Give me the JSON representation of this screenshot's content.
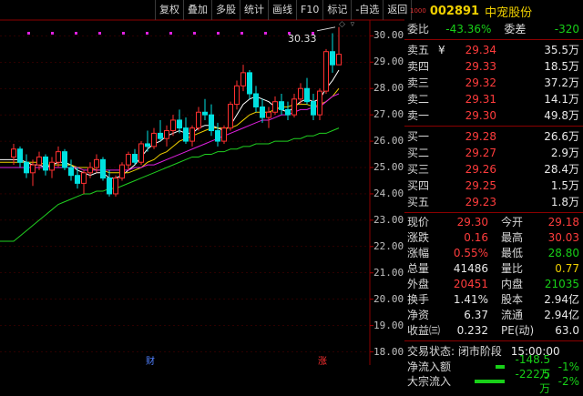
{
  "toolbar": {
    "buttons": [
      "复权",
      "叠加",
      "多股",
      "统计",
      "画线",
      "F10",
      "标记",
      "-自选",
      "返回"
    ]
  },
  "chart": {
    "y_labels": [
      "30.00",
      "29.00",
      "28.00",
      "27.00",
      "26.00",
      "25.00",
      "24.00",
      "23.00",
      "22.00",
      "21.00",
      "20.00",
      "19.00",
      "18.00"
    ],
    "max_price_label": "30.33",
    "bottom_markers": [
      "财",
      "涨"
    ],
    "colors": {
      "up": "#ff3030",
      "down": "#00e0e0",
      "ma5": "#ffffff",
      "ma10": "#f0d000",
      "ma20": "#e020e0",
      "ma60": "#20d020"
    }
  },
  "chart_data": {
    "type": "candlestick",
    "ylim": [
      17.5,
      30.6
    ],
    "y_ticks": [
      30,
      29,
      28,
      27,
      26,
      25,
      24,
      23,
      22,
      21,
      20,
      19,
      18
    ],
    "series": [
      {
        "values": [
          [
            25.4,
            25.9,
            25.1,
            25.7
          ],
          [
            25.7,
            25.8,
            25.0,
            25.2
          ],
          [
            25.2,
            25.5,
            24.6,
            24.8
          ],
          [
            24.8,
            25.3,
            24.3,
            25.1
          ],
          [
            25.1,
            25.6,
            24.9,
            25.4
          ],
          [
            25.4,
            25.5,
            24.7,
            24.9
          ],
          [
            24.9,
            25.4,
            24.6,
            25.2
          ],
          [
            25.2,
            25.8,
            25.0,
            25.6
          ],
          [
            25.6,
            25.7,
            24.9,
            25.0
          ],
          [
            25.0,
            25.3,
            24.5,
            24.7
          ],
          [
            24.7,
            25.0,
            24.2,
            24.4
          ],
          [
            24.4,
            24.9,
            24.0,
            24.8
          ],
          [
            24.8,
            25.2,
            24.6,
            25.0
          ],
          [
            25.0,
            25.5,
            24.8,
            25.3
          ],
          [
            25.3,
            25.4,
            24.5,
            24.6
          ],
          [
            24.6,
            24.9,
            23.9,
            24.0
          ],
          [
            24.0,
            24.7,
            23.9,
            24.6
          ],
          [
            24.6,
            25.2,
            24.5,
            25.1
          ],
          [
            25.1,
            25.6,
            24.9,
            25.5
          ],
          [
            25.5,
            25.7,
            25.1,
            25.2
          ],
          [
            25.2,
            26.0,
            25.1,
            25.9
          ],
          [
            25.9,
            26.4,
            25.6,
            25.8
          ],
          [
            25.8,
            26.5,
            25.7,
            26.3
          ],
          [
            26.3,
            26.8,
            26.0,
            26.1
          ],
          [
            26.1,
            26.6,
            25.8,
            26.4
          ],
          [
            26.4,
            27.0,
            26.2,
            26.8
          ],
          [
            26.8,
            27.2,
            26.3,
            26.5
          ],
          [
            26.5,
            26.9,
            25.9,
            26.0
          ],
          [
            26.0,
            26.6,
            25.8,
            26.5
          ],
          [
            26.5,
            27.3,
            26.4,
            27.1
          ],
          [
            27.1,
            27.6,
            26.8,
            27.0
          ],
          [
            27.0,
            27.4,
            26.2,
            26.4
          ],
          [
            26.4,
            26.7,
            25.8,
            26.0
          ],
          [
            26.0,
            26.6,
            25.9,
            26.5
          ],
          [
            26.5,
            27.5,
            26.4,
            27.4
          ],
          [
            27.4,
            28.3,
            27.2,
            28.1
          ],
          [
            28.1,
            28.9,
            27.9,
            28.6
          ],
          [
            28.6,
            28.7,
            27.6,
            27.8
          ],
          [
            27.8,
            28.1,
            27.1,
            27.3
          ],
          [
            27.3,
            27.6,
            26.7,
            26.9
          ],
          [
            26.9,
            27.3,
            26.5,
            27.1
          ],
          [
            27.1,
            27.7,
            27.0,
            27.5
          ],
          [
            27.5,
            27.8,
            27.0,
            27.2
          ],
          [
            27.2,
            27.5,
            26.8,
            27.0
          ],
          [
            27.0,
            27.8,
            26.9,
            27.6
          ],
          [
            27.6,
            28.2,
            27.4,
            28.0
          ],
          [
            28.0,
            28.4,
            27.4,
            27.5
          ],
          [
            27.5,
            27.8,
            26.8,
            27.0
          ],
          [
            27.0,
            28.0,
            26.8,
            27.9
          ],
          [
            27.9,
            29.5,
            27.8,
            29.4
          ],
          [
            29.4,
            30.1,
            28.6,
            28.9
          ],
          [
            28.9,
            30.33,
            28.9,
            29.3
          ]
        ]
      },
      {
        "name": "",
        "values": [
          25.3,
          25.3,
          25.2,
          25.1,
          25.1,
          25.0,
          25.1,
          25.2,
          25.2,
          25.1,
          24.9,
          24.8,
          24.7,
          24.8,
          24.8,
          24.6,
          24.6,
          24.7,
          24.9,
          25.1,
          25.4,
          25.7,
          25.9,
          26.0,
          26.2,
          26.3,
          26.4,
          26.3,
          26.3,
          26.5,
          26.6,
          26.6,
          26.5,
          26.4,
          26.6,
          27.0,
          27.4,
          27.6,
          27.7,
          27.6,
          27.5,
          27.3,
          27.2,
          27.1,
          27.3,
          27.5,
          27.6,
          27.5,
          27.6,
          28.0,
          28.3,
          28.7
        ]
      },
      {
        "name": "",
        "values": [
          25.2,
          25.2,
          25.2,
          25.2,
          25.2,
          25.1,
          25.1,
          25.1,
          25.1,
          25.1,
          25.0,
          25.0,
          25.0,
          24.9,
          24.9,
          24.8,
          24.8,
          24.8,
          24.8,
          24.9,
          25.0,
          25.2,
          25.3,
          25.5,
          25.6,
          25.8,
          26.0,
          26.1,
          26.2,
          26.3,
          26.4,
          26.5,
          26.5,
          26.5,
          26.5,
          26.6,
          26.8,
          27.0,
          27.1,
          27.1,
          27.1,
          27.2,
          27.3,
          27.3,
          27.4,
          27.4,
          27.4,
          27.3,
          27.4,
          27.5,
          27.7,
          28.0
        ]
      },
      {
        "name": "",
        "values": [
          25.0,
          25.0,
          25.0,
          25.0,
          25.0,
          25.0,
          25.0,
          25.0,
          25.0,
          25.0,
          25.0,
          24.9,
          24.9,
          24.9,
          24.9,
          24.9,
          24.9,
          24.9,
          24.9,
          25.0,
          25.0,
          25.1,
          25.1,
          25.2,
          25.3,
          25.4,
          25.5,
          25.6,
          25.7,
          25.8,
          25.9,
          26.0,
          26.1,
          26.2,
          26.3,
          26.4,
          26.5,
          26.6,
          26.7,
          26.8,
          26.8,
          26.9,
          27.0,
          27.0,
          27.1,
          27.2,
          27.2,
          27.3,
          27.3,
          27.5,
          27.7,
          27.8
        ]
      },
      {
        "name": "",
        "values": [
          22.2,
          22.4,
          22.6,
          22.8,
          23.0,
          23.2,
          23.4,
          23.6,
          23.7,
          23.8,
          23.9,
          24.0,
          24.0,
          24.1,
          24.1,
          24.2,
          24.2,
          24.3,
          24.4,
          24.5,
          24.6,
          24.7,
          24.8,
          24.9,
          25.0,
          25.1,
          25.2,
          25.3,
          25.4,
          25.4,
          25.5,
          25.5,
          25.6,
          25.6,
          25.7,
          25.7,
          25.8,
          25.8,
          25.9,
          25.9,
          25.9,
          26.0,
          26.0,
          26.0,
          26.1,
          26.1,
          26.2,
          26.2,
          26.3,
          26.3,
          26.4,
          26.5
        ]
      }
    ]
  },
  "stock": {
    "tag": "1000",
    "code": "002891",
    "name": "中宠股份"
  },
  "weibi": {
    "label1": "委比",
    "value1": "-43.36%",
    "label2": "委差",
    "value2": "-320"
  },
  "sell_orders": [
    {
      "label": "卖五",
      "sym": "¥",
      "price": "29.34",
      "qty": "35.5万"
    },
    {
      "label": "卖四",
      "price": "29.33",
      "qty": "18.5万"
    },
    {
      "label": "卖三",
      "price": "29.32",
      "qty": "37.2万"
    },
    {
      "label": "卖二",
      "price": "29.31",
      "qty": "14.1万"
    },
    {
      "label": "卖一",
      "price": "29.30",
      "qty": "49.8万"
    }
  ],
  "buy_orders": [
    {
      "label": "买一",
      "price": "29.28",
      "qty": "26.6万"
    },
    {
      "label": "买二",
      "price": "29.27",
      "qty": "2.9万"
    },
    {
      "label": "买三",
      "price": "29.26",
      "qty": "28.4万"
    },
    {
      "label": "买四",
      "price": "29.25",
      "qty": "1.5万"
    },
    {
      "label": "买五",
      "price": "29.23",
      "qty": "1.8万"
    }
  ],
  "quote": [
    {
      "k1": "现价",
      "v1": "29.30",
      "c1": "red",
      "k2": "今开",
      "v2": "29.18",
      "c2": "red"
    },
    {
      "k1": "涨跌",
      "v1": "0.16",
      "c1": "red",
      "k2": "最高",
      "v2": "30.03",
      "c2": "red"
    },
    {
      "k1": "涨幅",
      "v1": "0.55%",
      "c1": "red",
      "k2": "最低",
      "v2": "28.80",
      "c2": "green"
    },
    {
      "k1": "总量",
      "v1": "41486",
      "c1": "white",
      "k2": "量比",
      "v2": "0.77",
      "c2": "yellow"
    },
    {
      "k1": "外盘",
      "v1": "20451",
      "c1": "red",
      "k2": "内盘",
      "v2": "21035",
      "c2": "green"
    },
    {
      "k1": "换手",
      "v1": "1.41%",
      "c1": "white",
      "k2": "股本",
      "v2": "2.94亿",
      "c2": "white"
    },
    {
      "k1": "净资",
      "v1": "6.37",
      "c1": "white",
      "k2": "流通",
      "v2": "2.94亿",
      "c2": "white"
    },
    {
      "k1": "收益㈢",
      "v1": "0.232",
      "c1": "white",
      "k2": "PE(动)",
      "v2": "63.0",
      "c2": "white"
    }
  ],
  "status": {
    "label": "交易状态:",
    "value": "闭市阶段",
    "time": "15:00:00"
  },
  "flows": [
    {
      "label": "净流入额",
      "value": "-148.5万",
      "pct": "-1%",
      "bar": 0.25
    },
    {
      "label": "大宗流入",
      "value": "-222.5万",
      "pct": "-2%",
      "bar": 0.8
    }
  ]
}
